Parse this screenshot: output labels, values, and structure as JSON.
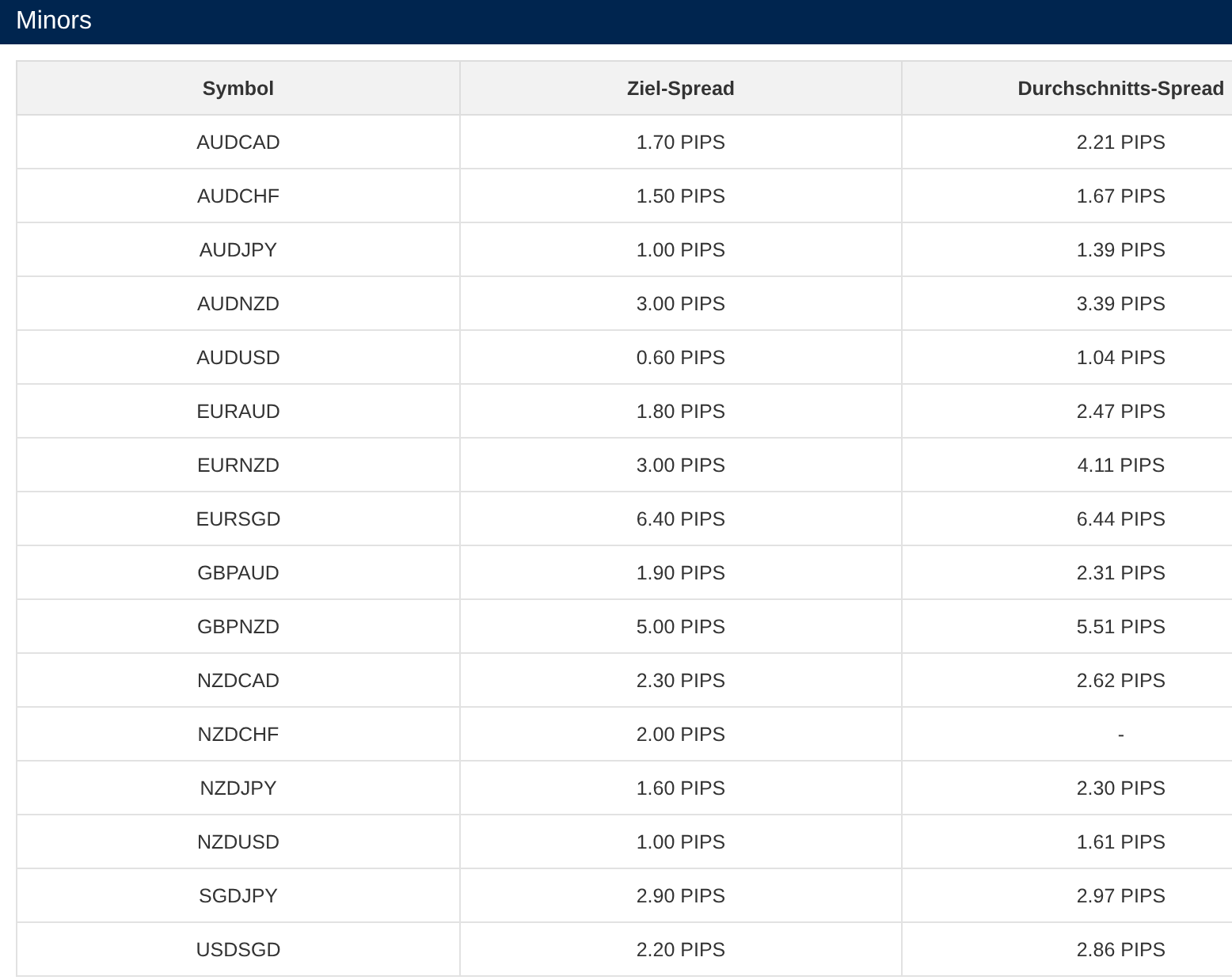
{
  "header": {
    "title": "Minors"
  },
  "table": {
    "columns": [
      "Symbol",
      "Ziel-Spread",
      "Durchschnitts-Spread"
    ],
    "rows": [
      [
        "AUDCAD",
        "1.70 PIPS",
        "2.21 PIPS"
      ],
      [
        "AUDCHF",
        "1.50 PIPS",
        "1.67 PIPS"
      ],
      [
        "AUDJPY",
        "1.00 PIPS",
        "1.39 PIPS"
      ],
      [
        "AUDNZD",
        "3.00 PIPS",
        "3.39 PIPS"
      ],
      [
        "AUDUSD",
        "0.60 PIPS",
        "1.04 PIPS"
      ],
      [
        "EURAUD",
        "1.80 PIPS",
        "2.47 PIPS"
      ],
      [
        "EURNZD",
        "3.00 PIPS",
        "4.11 PIPS"
      ],
      [
        "EURSGD",
        "6.40 PIPS",
        "6.44 PIPS"
      ],
      [
        "GBPAUD",
        "1.90 PIPS",
        "2.31 PIPS"
      ],
      [
        "GBPNZD",
        "5.00 PIPS",
        "5.51 PIPS"
      ],
      [
        "NZDCAD",
        "2.30 PIPS",
        "2.62 PIPS"
      ],
      [
        "NZDCHF",
        "2.00 PIPS",
        "-"
      ],
      [
        "NZDJPY",
        "1.60 PIPS",
        "2.30 PIPS"
      ],
      [
        "NZDUSD",
        "1.00 PIPS",
        "1.61 PIPS"
      ],
      [
        "SGDJPY",
        "2.90 PIPS",
        "2.97 PIPS"
      ],
      [
        "USDSGD",
        "2.20 PIPS",
        "2.86 PIPS"
      ]
    ]
  }
}
